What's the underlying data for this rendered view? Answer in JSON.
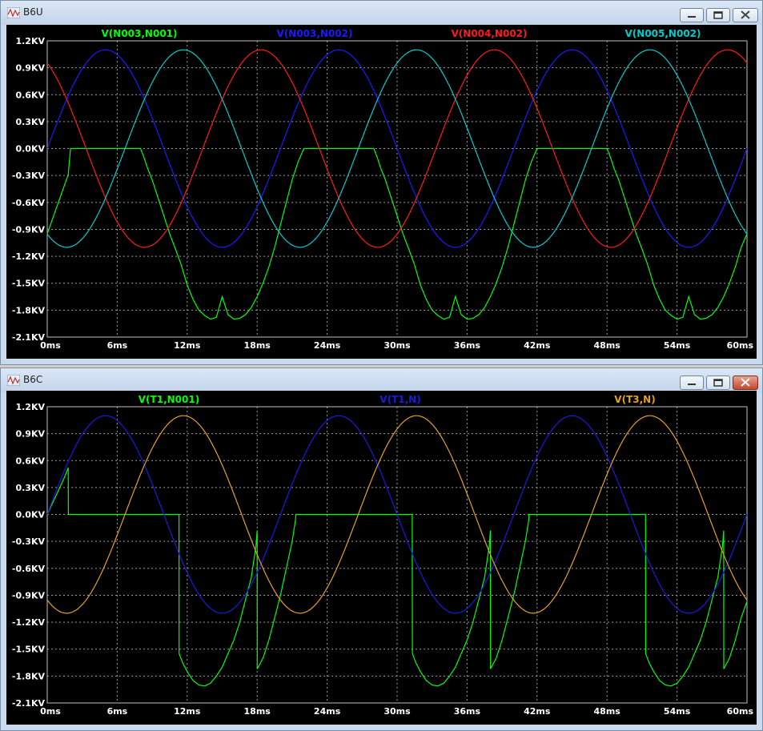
{
  "windows": [
    {
      "title": "B6U",
      "close_active": false,
      "chart_data": {
        "type": "line",
        "xlabel": "",
        "ylabel": "",
        "x_ticks": [
          "0ms",
          "6ms",
          "12ms",
          "18ms",
          "24ms",
          "30ms",
          "36ms",
          "42ms",
          "48ms",
          "54ms",
          "60ms"
        ],
        "y_ticks": [
          "1.2KV",
          "0.9KV",
          "0.6KV",
          "0.3KV",
          "0.0KV",
          "-0.3KV",
          "-0.6KV",
          "-0.9KV",
          "-1.2KV",
          "-1.5KV",
          "-1.8KV",
          "-2.1KV"
        ],
        "xlim": [
          0,
          60
        ],
        "ylim": [
          -2.1,
          1.2
        ],
        "grid": true,
        "series": [
          {
            "name": "V(N003,N001)",
            "color": "#00ff00",
            "x": [
              0,
              0.3,
              0.6,
              0.9,
              1.2,
              1.5,
              1.8,
              2,
              2.5,
              3,
              4,
              5,
              6,
              7,
              7.5,
              8,
              8.3,
              8.6,
              9,
              9.5,
              10,
              10.5,
              11,
              11.5,
              12,
              12.5,
              13,
              13.5,
              14,
              14.5,
              15,
              15.5,
              16,
              16.5,
              17,
              17.5,
              18,
              18.5,
              19,
              19.5,
              20,
              20.5,
              21,
              21.5,
              22,
              22.5,
              23,
              24,
              25,
              26,
              27,
              28,
              28.3,
              28.6,
              29,
              29.5,
              30,
              30.5,
              31,
              31.5,
              32,
              32.5,
              33,
              33.5,
              34,
              34.5,
              35,
              35.5,
              36,
              36.5,
              37,
              37.5,
              38,
              38.5,
              39,
              39.5,
              40,
              40.5,
              41,
              41.5,
              42,
              42.5,
              43,
              44,
              45,
              46,
              47,
              48,
              48.3,
              48.6,
              49,
              49.5,
              50,
              50.5,
              51,
              51.5,
              52,
              52.5,
              53,
              53.5,
              54,
              54.5,
              55,
              55.5,
              56,
              56.5,
              57,
              57.5,
              58,
              58.5,
              59,
              59.5,
              60
            ],
            "y": [
              -0.95,
              -0.84,
              -0.73,
              -0.62,
              -0.51,
              -0.4,
              -0.29,
              0,
              0,
              0,
              0,
              0,
              0,
              0,
              0,
              0,
              -0.1,
              -0.22,
              -0.35,
              -0.55,
              -0.75,
              -0.95,
              -1.12,
              -1.3,
              -1.52,
              -1.68,
              -1.8,
              -1.86,
              -1.9,
              -1.88,
              -1.65,
              -1.85,
              -1.9,
              -1.89,
              -1.85,
              -1.77,
              -1.65,
              -1.5,
              -1.32,
              -1.1,
              -0.85,
              -0.6,
              -0.35,
              -0.15,
              0,
              0,
              0,
              0,
              0,
              0,
              0,
              0,
              -0.1,
              -0.22,
              -0.35,
              -0.55,
              -0.75,
              -0.95,
              -1.12,
              -1.3,
              -1.52,
              -1.68,
              -1.8,
              -1.86,
              -1.9,
              -1.88,
              -1.65,
              -1.85,
              -1.9,
              -1.89,
              -1.85,
              -1.77,
              -1.65,
              -1.5,
              -1.32,
              -1.1,
              -0.85,
              -0.6,
              -0.35,
              -0.15,
              0,
              0,
              0,
              0,
              0,
              0,
              0,
              0,
              -0.1,
              -0.22,
              -0.35,
              -0.55,
              -0.75,
              -0.95,
              -1.12,
              -1.3,
              -1.52,
              -1.68,
              -1.8,
              -1.86,
              -1.9,
              -1.88,
              -1.65,
              -1.85,
              -1.9,
              -1.89,
              -1.85,
              -1.77,
              -1.65,
              -1.5,
              -1.32,
              -1.1,
              -0.95
            ]
          },
          {
            "name": "V(N003,N002)",
            "color": "#1a1aff",
            "amp": 1.1,
            "phase": 0,
            "period": 20
          },
          {
            "name": "V(N004,N002)",
            "color": "#ff1a1a",
            "amp": 1.1,
            "phase": 120,
            "period": 20
          },
          {
            "name": "V(N005,N002)",
            "color": "#00cccc",
            "amp": 1.1,
            "phase": 240,
            "period": 20
          }
        ]
      }
    },
    {
      "title": "B6C",
      "close_active": true,
      "chart_data": {
        "type": "line",
        "xlabel": "",
        "ylabel": "",
        "x_ticks": [
          "0ms",
          "6ms",
          "12ms",
          "18ms",
          "24ms",
          "30ms",
          "36ms",
          "42ms",
          "48ms",
          "54ms",
          "60ms"
        ],
        "y_ticks": [
          "1.2KV",
          "0.9KV",
          "0.6KV",
          "0.3KV",
          "0.0KV",
          "-0.3KV",
          "-0.6KV",
          "-0.9KV",
          "-1.2KV",
          "-1.5KV",
          "-1.8KV",
          "-2.1KV"
        ],
        "xlim": [
          0,
          60
        ],
        "ylim": [
          -2.1,
          1.2
        ],
        "grid": true,
        "series": [
          {
            "name": "V(T1,N001)",
            "color": "#00ff00",
            "x": [
              0,
              0.5,
              1,
              1.5,
              1.8,
              1.81,
              5,
              9,
              11.3,
              11.31,
              11.6,
              12,
              12.5,
              13,
              13.5,
              14,
              14.5,
              15,
              15.5,
              16,
              16.5,
              17,
              17.5,
              17.9,
              18,
              18.01,
              18.5,
              19,
              19.5,
              20,
              20.5,
              21,
              21.3,
              21.31,
              24,
              28,
              31.3,
              31.31,
              31.6,
              32,
              32.5,
              33,
              33.5,
              34,
              34.5,
              35,
              35.5,
              36,
              36.5,
              37,
              37.5,
              37.9,
              38,
              38.01,
              38.5,
              39,
              39.5,
              40,
              40.5,
              41,
              41.3,
              41.31,
              44,
              48,
              51.3,
              51.31,
              51.6,
              52,
              52.5,
              53,
              53.5,
              54,
              54.5,
              55,
              55.5,
              56,
              56.5,
              57,
              57.5,
              57.9,
              58,
              58.01,
              58.5,
              59,
              59.5,
              60
            ],
            "y": [
              0,
              0.14,
              0.28,
              0.42,
              0.52,
              0,
              0,
              0,
              0,
              -1.55,
              -1.65,
              -1.75,
              -1.85,
              -1.9,
              -1.91,
              -1.88,
              -1.8,
              -1.7,
              -1.55,
              -1.4,
              -1.2,
              -0.95,
              -0.7,
              -0.35,
              -0.18,
              -1.72,
              -1.6,
              -1.4,
              -1.15,
              -0.9,
              -0.6,
              -0.3,
              -0.05,
              0,
              0,
              0,
              0,
              -1.55,
              -1.65,
              -1.75,
              -1.85,
              -1.9,
              -1.91,
              -1.88,
              -1.8,
              -1.7,
              -1.55,
              -1.4,
              -1.2,
              -0.95,
              -0.7,
              -0.35,
              -0.18,
              -1.72,
              -1.6,
              -1.4,
              -1.15,
              -0.9,
              -0.6,
              -0.3,
              -0.05,
              0,
              0,
              0,
              0,
              -1.55,
              -1.65,
              -1.75,
              -1.85,
              -1.9,
              -1.91,
              -1.88,
              -1.8,
              -1.7,
              -1.55,
              -1.4,
              -1.2,
              -0.95,
              -0.7,
              -0.35,
              -0.18,
              -1.72,
              -1.6,
              -1.4,
              -1.15,
              -0.97
            ]
          },
          {
            "name": "V(T1,N)",
            "color": "#1a1ae0",
            "amp": 1.1,
            "phase": 0,
            "period": 20
          },
          {
            "name": "V(T3,N)",
            "color": "#e6a020",
            "amp": 1.1,
            "phase": 240,
            "period": 20
          }
        ]
      }
    }
  ]
}
